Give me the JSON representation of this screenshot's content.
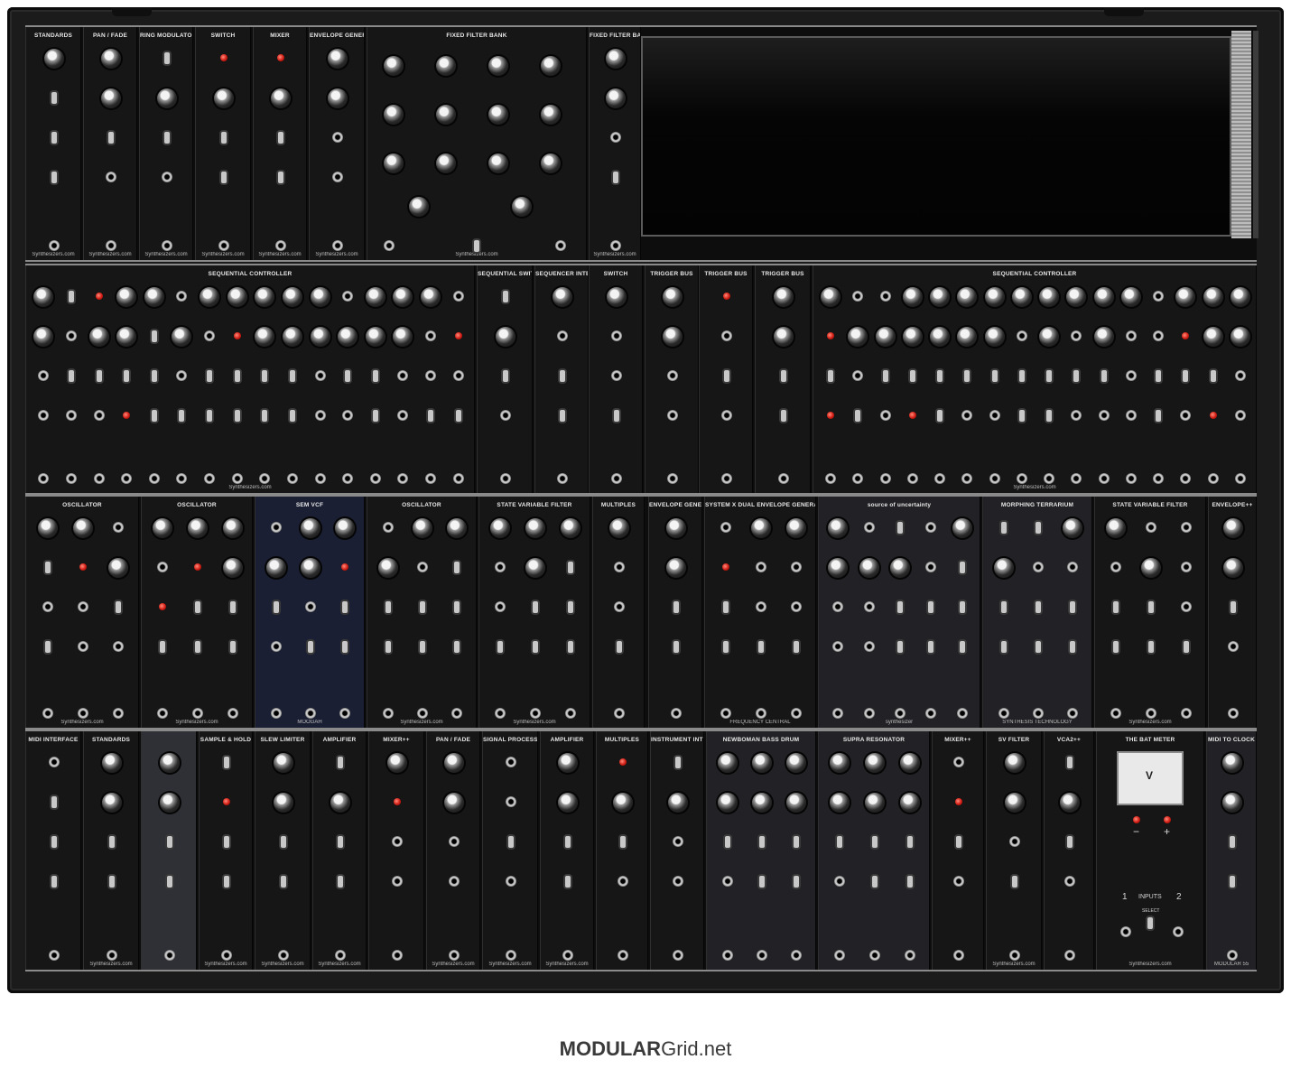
{
  "logo": {
    "bold": "MODULAR",
    "rest": "Grid.net"
  },
  "rows": [
    {
      "modules": [
        {
          "title": "STANDARDS",
          "footer": "Synthesizers.com"
        },
        {
          "title": "PAN / FADE",
          "footer": "Synthesizers.com"
        },
        {
          "title": "RING MODULATOR",
          "footer": "Synthesizers.com"
        },
        {
          "title": "SWITCH",
          "footer": "Synthesizers.com"
        },
        {
          "title": "MIXER",
          "footer": "Synthesizers.com"
        },
        {
          "title": "ENVELOPE GENERATOR",
          "footer": "Synthesizers.com"
        },
        {
          "title": "FIXED FILTER BANK",
          "footer": "Synthesizers.com"
        },
        {
          "title": "FIXED FILTER BANK AID",
          "footer": "Synthesizers.com"
        }
      ]
    },
    {
      "modules": [
        {
          "title": "SEQUENTIAL CONTROLLER",
          "footer": "Synthesizers.com"
        },
        {
          "title": "SEQUENTIAL SWITCH",
          "footer": ""
        },
        {
          "title": "SEQUENCER INTERFACE",
          "footer": ""
        },
        {
          "title": "SWITCH",
          "footer": ""
        },
        {
          "title": "TRIGGER BUS",
          "footer": ""
        },
        {
          "title": "TRIGGER BUS",
          "footer": ""
        },
        {
          "title": "TRIGGER BUS",
          "footer": ""
        },
        {
          "title": "SEQUENTIAL CONTROLLER",
          "footer": "Synthesizers.com"
        }
      ]
    },
    {
      "modules": [
        {
          "title": "OSCILLATOR",
          "footer": "Synthesizers.com"
        },
        {
          "title": "OSCILLATOR",
          "footer": "Synthesizers.com"
        },
        {
          "title": "SEM VCF",
          "footer": "MOOGAH"
        },
        {
          "title": "OSCILLATOR",
          "footer": "Synthesizers.com"
        },
        {
          "title": "STATE VARIABLE FILTER",
          "footer": "Synthesizers.com"
        },
        {
          "title": "MULTIPLES",
          "footer": ""
        },
        {
          "title": "ENVELOPE GENERATOR",
          "footer": ""
        },
        {
          "title": "SYSTEM X DUAL ENVELOPE GENERATOR",
          "footer": "FREQUENCY CENTRAL"
        },
        {
          "title": "source of uncertainty",
          "footer": "synthesizer"
        },
        {
          "title": "MORPHING TERRARIUM",
          "footer": "SYNTHESIS TECHNOLOGY"
        },
        {
          "title": "STATE VARIABLE FILTER",
          "footer": "Synthesizers.com"
        },
        {
          "title": "ENVELOPE++",
          "footer": ""
        }
      ]
    },
    {
      "modules": [
        {
          "title": "MIDI INTERFACE",
          "footer": ""
        },
        {
          "title": "STANDARDS",
          "footer": "Synthesizers.com"
        },
        {
          "title": "",
          "footer": ""
        },
        {
          "title": "SAMPLE & HOLD",
          "footer": "Synthesizers.com"
        },
        {
          "title": "SLEW LIMITER",
          "footer": "Synthesizers.com"
        },
        {
          "title": "AMPLIFIER",
          "footer": "Synthesizers.com"
        },
        {
          "title": "MIXER++",
          "footer": ""
        },
        {
          "title": "PAN / FADE",
          "footer": "Synthesizers.com"
        },
        {
          "title": "SIGNAL PROCESSOR",
          "footer": "Synthesizers.com"
        },
        {
          "title": "AMPLIFIER",
          "footer": "Synthesizers.com"
        },
        {
          "title": "MULTIPLES",
          "footer": ""
        },
        {
          "title": "INSTRUMENT INTERFACE",
          "footer": ""
        },
        {
          "title": "NEWBOMAN BASS DRUM",
          "footer": ""
        },
        {
          "title": "SUPRA RESONATOR",
          "footer": ""
        },
        {
          "title": "MIXER++",
          "footer": ""
        },
        {
          "title": "SV FILTER",
          "footer": "Synthesizers.com"
        },
        {
          "title": "VCA2++",
          "footer": ""
        },
        {
          "title": "THE BAT METER",
          "footer": "Synthesizers.com"
        },
        {
          "title": "MIDI TO CLOCK",
          "footer": "MODULAR 55"
        }
      ]
    }
  ],
  "bat_meter": {
    "inputs_label": "INPUTS",
    "in1": "1",
    "in2": "2",
    "select": "SELECT",
    "minus": "−",
    "plus": "+",
    "unit": "V"
  }
}
